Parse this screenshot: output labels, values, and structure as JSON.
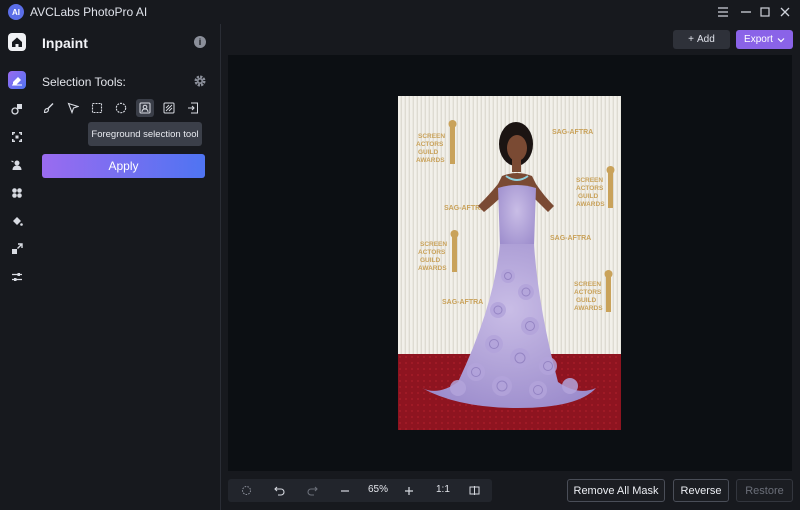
{
  "window": {
    "title": "AVCLabs PhotoPro AI",
    "logo_text": "AI"
  },
  "rail": {
    "items": [
      {
        "name": "home-icon"
      },
      {
        "name": "inpaint-icon",
        "active": true
      },
      {
        "name": "replace-icon"
      },
      {
        "name": "expand-icon"
      },
      {
        "name": "remove-bg-icon"
      },
      {
        "name": "color-icon"
      },
      {
        "name": "fill-icon"
      },
      {
        "name": "upscale-icon"
      },
      {
        "name": "adjust-icon"
      }
    ]
  },
  "panel": {
    "title": "Inpaint",
    "selection_label": "Selection Tools:",
    "tools": [
      "brush-tool-icon",
      "lasso-tool-icon",
      "rectangle-tool-icon",
      "ellipse-tool-icon",
      "foreground-tool-icon",
      "pattern-tool-icon",
      "import-mask-icon"
    ],
    "active_tool_index": 4,
    "tooltip": "Foreground selection tool",
    "apply_label": "Apply"
  },
  "actions": {
    "add_label": "Add",
    "export_label": "Export"
  },
  "photo": {
    "backdrop_logo_1": "SCREEN ACTORS GUILD AWARDS",
    "backdrop_logo_2": "SAG-AFTRA"
  },
  "zoombar": {
    "zoom_level": "65%",
    "actual_size": "1:1"
  },
  "footer": {
    "remove_all_label": "Remove All Mask",
    "reverse_label": "Reverse",
    "restore_label": "Restore"
  },
  "colors": {
    "accent_purple": "#8a63e8",
    "accent_blue": "#4f74f2",
    "background": "#17191e",
    "canvas": "#0c0f13"
  }
}
